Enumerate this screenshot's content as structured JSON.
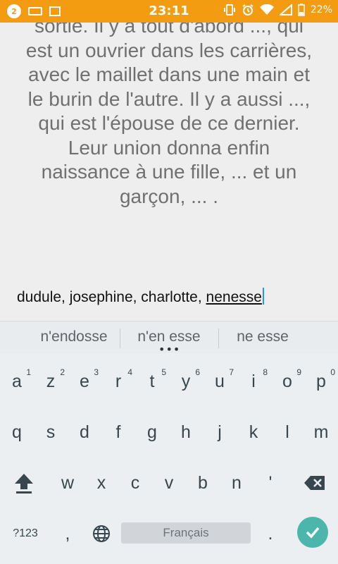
{
  "status_bar": {
    "time": "23:11",
    "battery": "22%",
    "notif_badge": "2",
    "icons": [
      "notification-badge-icon",
      "keyboard-icon",
      "image-icon",
      "vibrate-icon",
      "alarm-icon",
      "wifi-icon",
      "signal-icon",
      "battery-icon"
    ]
  },
  "passage": {
    "lines": [
      "sortie. Il y a tout d'abord ..., qui",
      "est un ouvrier dans les carrières,",
      "avec le maillet dans une main et",
      "le burin de l'autre. Il y a aussi ...,",
      "qui est l'épouse de ce dernier.",
      "Leur union donna enfin",
      "naissance à une fille, ... et un",
      "garçon, ... ."
    ]
  },
  "answer": {
    "committed": "dudule, josephine, charlotte, ",
    "composing": "nenesse"
  },
  "suggestions": [
    "n'endosse",
    "n'en esse",
    "ne esse"
  ],
  "suggestions_more": "•••",
  "keyboard": {
    "row1": [
      {
        "label": "a",
        "hint": "1"
      },
      {
        "label": "z",
        "hint": "2"
      },
      {
        "label": "e",
        "hint": "3"
      },
      {
        "label": "r",
        "hint": "4"
      },
      {
        "label": "t",
        "hint": "5"
      },
      {
        "label": "y",
        "hint": "6"
      },
      {
        "label": "u",
        "hint": "7"
      },
      {
        "label": "i",
        "hint": "8"
      },
      {
        "label": "o",
        "hint": "9"
      },
      {
        "label": "p",
        "hint": "0"
      }
    ],
    "row2": [
      "q",
      "s",
      "d",
      "f",
      "g",
      "h",
      "j",
      "k",
      "l",
      "m"
    ],
    "row3": [
      "w",
      "x",
      "c",
      "v",
      "b",
      "n",
      "'"
    ],
    "symbols_label": "?123",
    "comma": ",",
    "period": ".",
    "space_label": "Français",
    "accent_color": "#4db6ac"
  }
}
